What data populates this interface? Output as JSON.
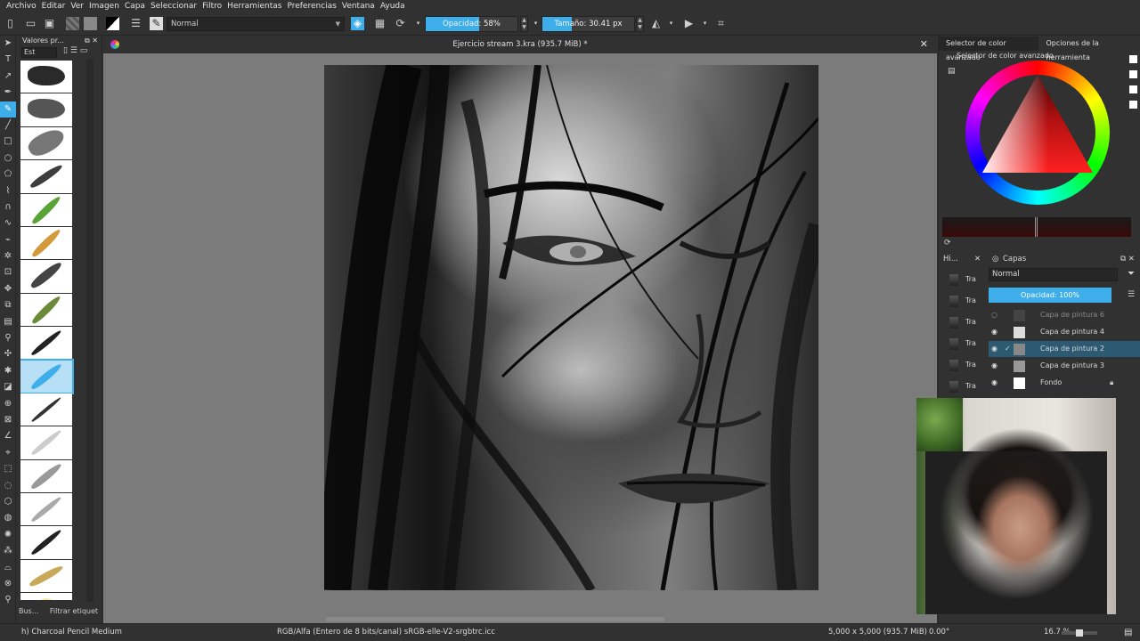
{
  "menu": [
    "Archivo",
    "Editar",
    "Ver",
    "Imagen",
    "Capa",
    "Seleccionar",
    "Filtro",
    "Herramientas",
    "Preferencias",
    "Ventana",
    "Ayuda"
  ],
  "toolbar": {
    "blend_mode": "Normal",
    "opacity_label": "Opacidad: 58%",
    "opacity_value": 58,
    "size_label": "Tamaño: 30.41 px",
    "size_fill_fraction": 0.32
  },
  "presets": {
    "title": "Valores pr...",
    "combo": "Est",
    "filter_label": "Filtrar etiquet",
    "search_label": "Bus..."
  },
  "document": {
    "title": "Ejercicio stream 3.kra (935.7 MiB) *"
  },
  "right_panel": {
    "tab_color": "Selector de color avanzado",
    "tab_tool": "Opciones de la herramienta",
    "color_title": "Selector de color avanzado"
  },
  "layers": {
    "panel_title": "Capas",
    "history_label": "Hi...",
    "mode": "Normal",
    "opacity_label": "Opacidad:  100%",
    "history_items": [
      "Tra",
      "Tra",
      "Tra",
      "Tra",
      "Tra",
      "Tra"
    ],
    "items": [
      {
        "name": "Capa de pintura 6",
        "visible": false,
        "selected": false
      },
      {
        "name": "Capa de pintura 4",
        "visible": true,
        "selected": false
      },
      {
        "name": "Capa de pintura 2",
        "visible": true,
        "selected": true
      },
      {
        "name": "Capa de pintura 3",
        "visible": true,
        "selected": false
      },
      {
        "name": "Fondo",
        "visible": true,
        "selected": false
      }
    ]
  },
  "status": {
    "brush": "h) Charcoal Pencil Medium",
    "color_space": "RGB/Alfa (Entero de 8 bits/canal)  sRGB-elle-V2-srgbtrc.icc",
    "dimensions": "5,000 x 5,000 (935.7 MiB)",
    "rotation": "0.00°",
    "zoom": "16.7 %"
  },
  "colors": {
    "accent": "#3daee9",
    "bg": "#313131",
    "canvas_bg": "#7b7b7b"
  }
}
